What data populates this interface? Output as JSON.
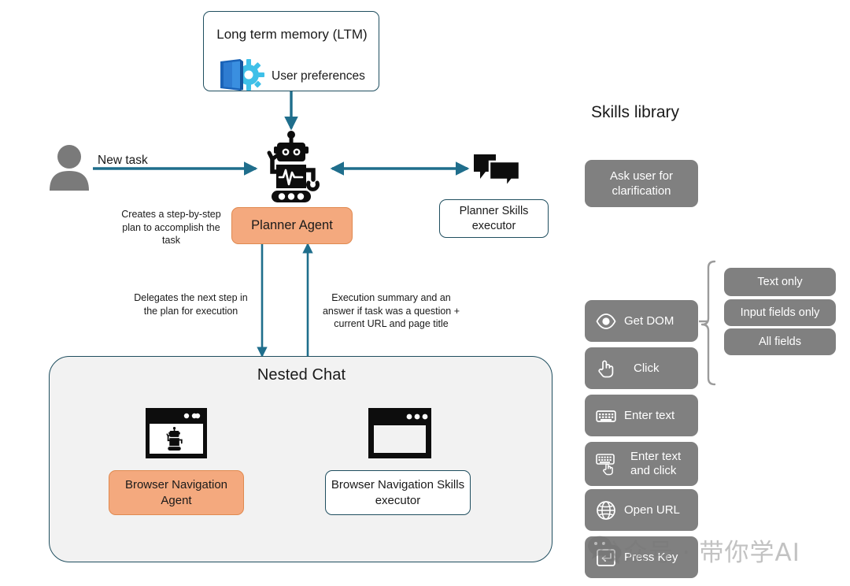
{
  "diagram": {
    "ltm": {
      "title": "Long term memory (LTM)",
      "icon": "book-gear-icon",
      "item_label": "User preferences"
    },
    "user": {
      "icon": "user-avatar-icon",
      "edge_label": "New task"
    },
    "planner": {
      "robot_icon": "robot-icon",
      "box_label": "Planner Agent",
      "side_note": "Creates a step-by-step plan to accomplish the task"
    },
    "planner_skills": {
      "icon": "chat-bubbles-icon",
      "box_label": "Planner Skills executor"
    },
    "edges": {
      "down_label": "Delegates the next step in the plan for execution",
      "up_label": "Execution summary and an answer if task was a question + current URL and page title"
    },
    "nested_chat": {
      "title": "Nested Chat",
      "left": {
        "icon": "browser-window-robot-icon",
        "box_label": "Browser Navigation Agent"
      },
      "right": {
        "icon": "browser-window-icon",
        "box_label": "Browser Navigation Skills executor"
      }
    }
  },
  "skills_library": {
    "title": "Skills library",
    "standalone": {
      "label": "Ask user for clarification",
      "icon": "none"
    },
    "items": [
      {
        "label": "Get DOM",
        "icon": "eye-icon"
      },
      {
        "label": "Click",
        "icon": "pointing-hand-icon"
      },
      {
        "label": "Enter text",
        "icon": "keyboard-icon"
      },
      {
        "label": "Enter text and click",
        "icon": "keyboard-hand-icon"
      },
      {
        "label": "Open URL",
        "icon": "globe-icon"
      },
      {
        "label": "Press Key",
        "icon": "enter-key-icon"
      }
    ],
    "get_dom_options": [
      {
        "label": "Text only"
      },
      {
        "label": "Input fields only"
      },
      {
        "label": "All fields"
      }
    ]
  },
  "watermark": {
    "text": "公众号 · 带你学AI",
    "logo_icon": "wechat-logo-icon"
  },
  "colors": {
    "accent_arrow": "#1F6E8C",
    "box_border": "#1F4E5F",
    "orange_fill": "#F4A97E",
    "orange_border": "#E08A50",
    "gray_fill": "#808080",
    "panel_fill": "#F2F2F2",
    "book_blue": "#2B7FD4",
    "gear_cyan": "#3FC0E8"
  }
}
